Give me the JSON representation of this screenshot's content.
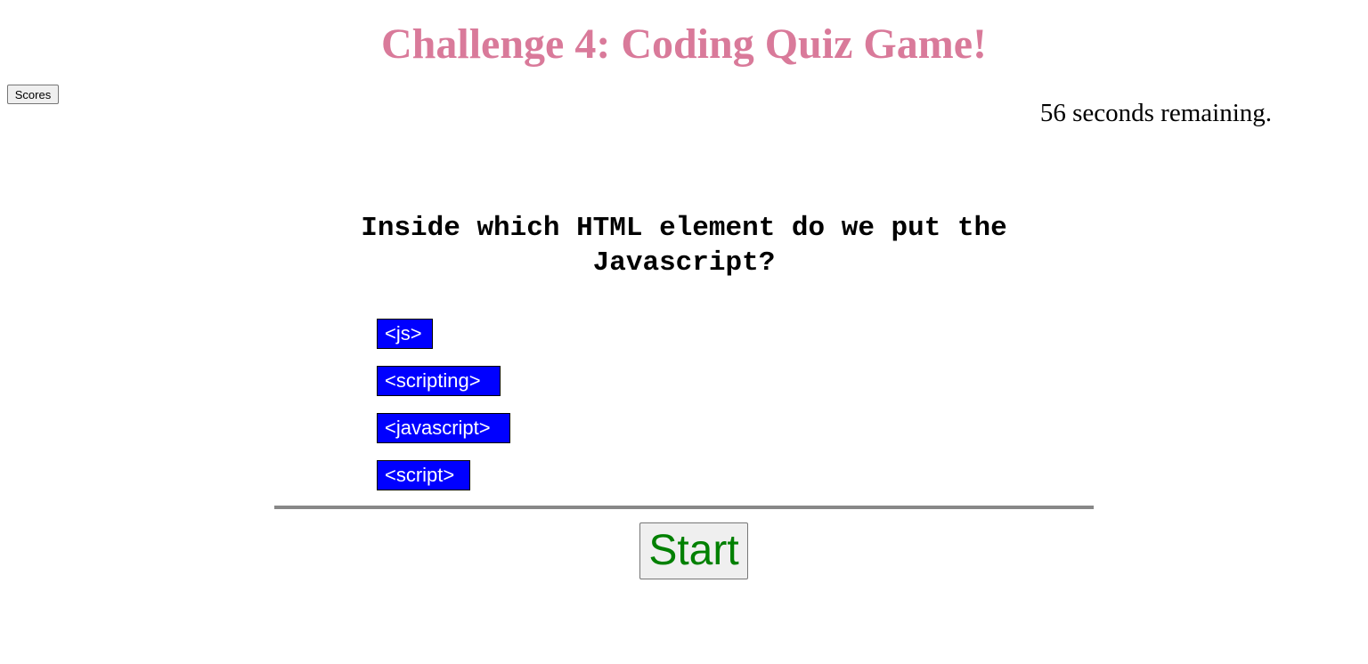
{
  "header": {
    "title": "Challenge 4: Coding Quiz Game!",
    "title_color": "#d97a9a"
  },
  "toolbar": {
    "scores_label": "Scores"
  },
  "timer": {
    "text": "56 seconds remaining."
  },
  "quiz": {
    "question": "Inside which HTML element do we put the Javascript?",
    "choices": [
      {
        "label": "<js>"
      },
      {
        "label": "<scripting>"
      },
      {
        "label": "<javascript>"
      },
      {
        "label": "<script>"
      }
    ],
    "choice_bg_color": "#0000ff"
  },
  "controls": {
    "start_label": "Start",
    "start_color": "#008000"
  }
}
